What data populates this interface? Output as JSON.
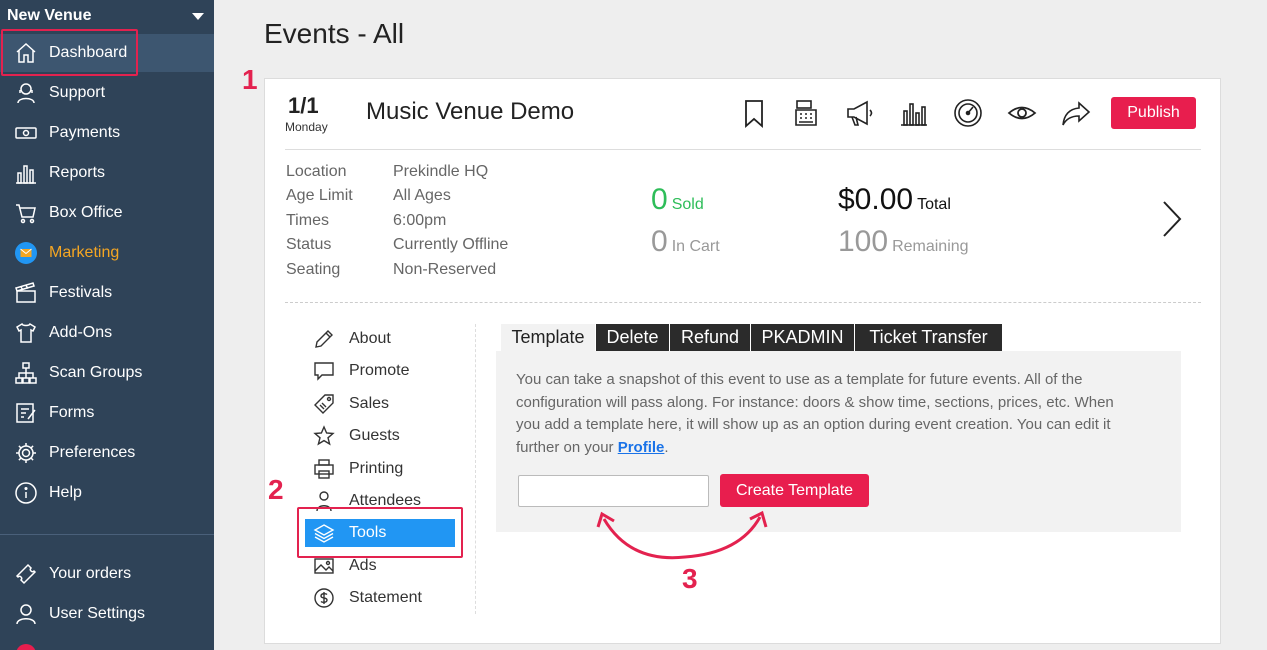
{
  "sidebar": {
    "venue": "New Venue",
    "items": [
      {
        "label": "Dashboard",
        "icon": "home-icon"
      },
      {
        "label": "Support",
        "icon": "headset-icon"
      },
      {
        "label": "Payments",
        "icon": "money-icon"
      },
      {
        "label": "Reports",
        "icon": "bar-chart-icon"
      },
      {
        "label": "Box Office",
        "icon": "cart-icon"
      },
      {
        "label": "Marketing",
        "icon": "mail-icon"
      },
      {
        "label": "Festivals",
        "icon": "clapperboard-icon"
      },
      {
        "label": "Add-Ons",
        "icon": "tshirt-icon"
      },
      {
        "label": "Scan Groups",
        "icon": "sitemap-icon"
      },
      {
        "label": "Forms",
        "icon": "form-icon"
      },
      {
        "label": "Preferences",
        "icon": "gear-icon"
      },
      {
        "label": "Help",
        "icon": "info-icon"
      }
    ],
    "bottom_items": [
      {
        "label": "Your orders",
        "icon": "ticket-icon"
      },
      {
        "label": "User Settings",
        "icon": "user-icon"
      }
    ]
  },
  "page": {
    "title": "Events - All"
  },
  "event": {
    "date": "1/1",
    "day": "Monday",
    "name": "Music Venue Demo",
    "publish_label": "Publish",
    "header_icons": [
      "bookmark-icon",
      "register-icon",
      "megaphone-icon",
      "chart-icon",
      "gauge-icon",
      "eye-icon",
      "share-icon"
    ],
    "info": [
      {
        "label": "Location",
        "value": "Prekindle HQ"
      },
      {
        "label": "Age Limit",
        "value": "All Ages"
      },
      {
        "label": "Times",
        "value": "6:00pm"
      },
      {
        "label": "Status",
        "value": "Currently Offline"
      },
      {
        "label": "Seating",
        "value": "Non-Reserved"
      }
    ],
    "stats": {
      "sold_value": "0",
      "sold_label": "Sold",
      "cart_value": "0",
      "cart_label": "In Cart",
      "total_value": "$0.00",
      "total_label": "Total",
      "remaining_value": "100",
      "remaining_label": "Remaining"
    }
  },
  "menu": [
    {
      "label": "About",
      "icon": "pencil-icon"
    },
    {
      "label": "Promote",
      "icon": "speech-bubble-icon"
    },
    {
      "label": "Sales",
      "icon": "tag-icon"
    },
    {
      "label": "Guests",
      "icon": "star-icon"
    },
    {
      "label": "Printing",
      "icon": "printer-icon"
    },
    {
      "label": "Attendees",
      "icon": "person-icon"
    },
    {
      "label": "Tools",
      "icon": "layers-icon"
    },
    {
      "label": "Ads",
      "icon": "image-icon"
    },
    {
      "label": "Statement",
      "icon": "dollar-icon"
    }
  ],
  "tabs": [
    "Template",
    "Delete",
    "Refund",
    "PKADMIN",
    "Ticket Transfer"
  ],
  "template": {
    "description": "You can take a snapshot of this event to use as a template for future events. All of the configuration will pass along. For instance: doors & show time, sections, prices, etc. When you add a template here, it will show up as an option during event creation. You can edit it further on your ",
    "profile_link": "Profile",
    "suffix": ".",
    "input_value": "",
    "button_label": "Create Template"
  },
  "annotations": [
    "1",
    "2",
    "3"
  ],
  "colors": {
    "sidebar": "#2f4358",
    "accent": "#e81e4e",
    "active_menu": "#2196f3",
    "marketing": "#f5a623",
    "sold": "#2ebd59"
  }
}
